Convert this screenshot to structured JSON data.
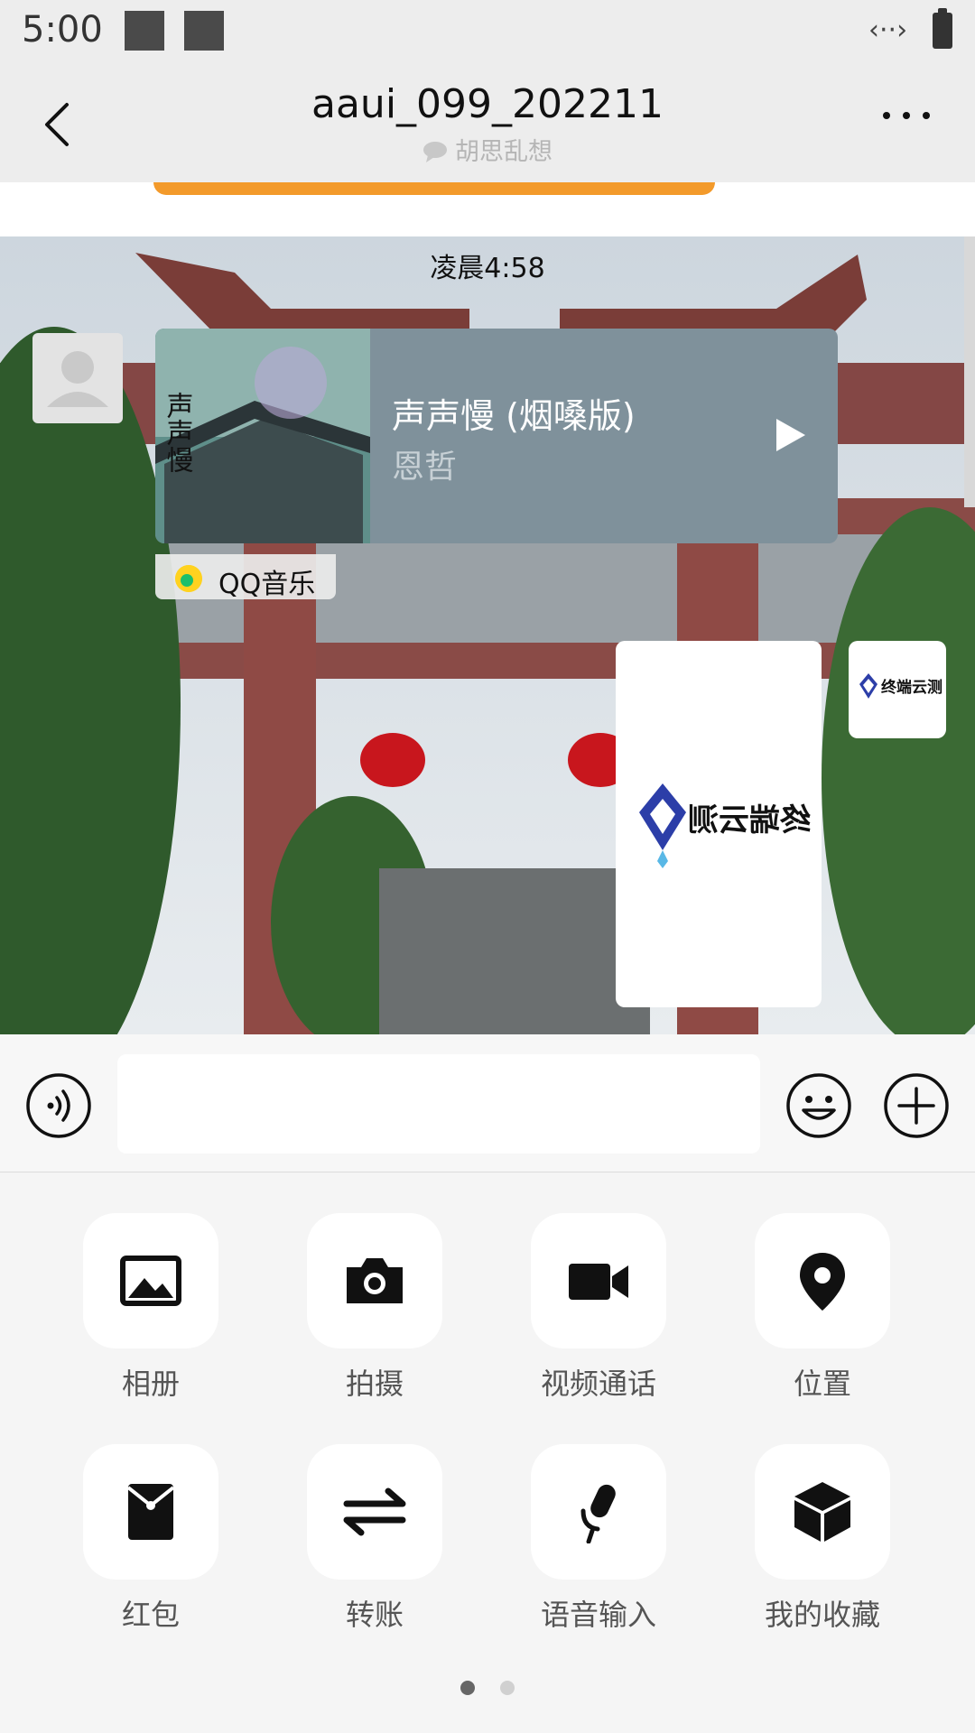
{
  "status_bar": {
    "time": "5:00",
    "signal_text": "‹··›"
  },
  "header": {
    "title": "aaui_099_202211",
    "subtitle": "胡思乱想"
  },
  "chat": {
    "timestamp": "凌晨4:58",
    "music_card": {
      "song_title": "声声慢 (烟嗓版)",
      "artist": "恩哲",
      "cover_text": "声声慢",
      "source": "QQ音乐"
    },
    "logo_text": "终端云测"
  },
  "input_bar": {
    "text_value": "",
    "placeholder": ""
  },
  "panel": {
    "items": [
      {
        "label": "相册",
        "icon": "album-icon"
      },
      {
        "label": "拍摄",
        "icon": "camera-icon"
      },
      {
        "label": "视频通话",
        "icon": "video-call-icon"
      },
      {
        "label": "位置",
        "icon": "location-icon"
      },
      {
        "label": "红包",
        "icon": "red-packet-icon"
      },
      {
        "label": "转账",
        "icon": "transfer-icon"
      },
      {
        "label": "语音输入",
        "icon": "microphone-icon"
      },
      {
        "label": "我的收藏",
        "icon": "favorites-icon"
      }
    ],
    "page_count": 2,
    "current_page": 1
  }
}
